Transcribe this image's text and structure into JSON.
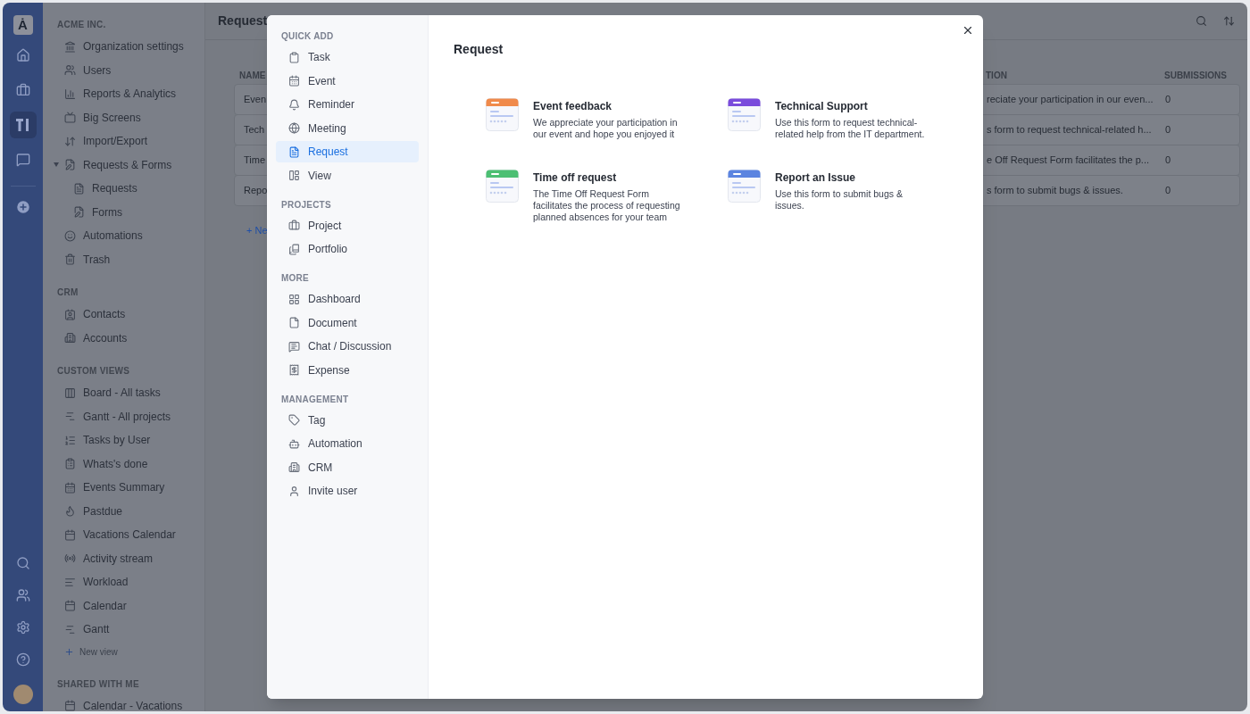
{
  "rail": {
    "logo": "Ȧ",
    "items": [
      {
        "selected": false
      },
      {
        "selected": false
      },
      {
        "selected": true
      },
      {
        "selected": false
      }
    ]
  },
  "sidebar": {
    "sections": [
      {
        "title": "ACME INC.",
        "items": [
          {
            "label": "Organization settings"
          },
          {
            "label": "Users"
          },
          {
            "label": "Reports & Analytics"
          },
          {
            "label": "Big Screens"
          },
          {
            "label": "Import/Export"
          },
          {
            "label": "Requests & Forms",
            "expanded": true,
            "children": [
              {
                "label": "Requests"
              },
              {
                "label": "Forms"
              }
            ]
          },
          {
            "label": "Automations"
          },
          {
            "label": "Trash"
          }
        ]
      },
      {
        "title": "CRM",
        "items": [
          {
            "label": "Contacts"
          },
          {
            "label": "Accounts"
          }
        ]
      },
      {
        "title": "CUSTOM VIEWS",
        "items": [
          {
            "label": "Board - All tasks"
          },
          {
            "label": "Gantt - All projects"
          },
          {
            "label": "Tasks by User"
          },
          {
            "label": "Whats's done"
          },
          {
            "label": "Events Summary"
          },
          {
            "label": "Pastdue"
          },
          {
            "label": "Vacations Calendar"
          },
          {
            "label": "Activity stream"
          },
          {
            "label": "Workload"
          },
          {
            "label": "Calendar"
          },
          {
            "label": "Gantt"
          }
        ],
        "add_link": "New view"
      },
      {
        "title": "SHARED WITH ME",
        "items": [
          {
            "label": "Calendar - Vacations"
          }
        ]
      }
    ]
  },
  "page": {
    "title": "Request",
    "table": {
      "columns": [
        "NAME",
        "TION",
        "SUBMISSIONS"
      ],
      "rows": [
        {
          "name": "Even",
          "description": "reciate your participation in our even...",
          "submissions": "0"
        },
        {
          "name": "Tech",
          "description": "s form to request technical-related h...",
          "submissions": "0"
        },
        {
          "name": "Time",
          "description": "e Off Request Form facilitates the p...",
          "submissions": "0"
        },
        {
          "name": "Repo",
          "description": "s form to submit bugs & issues.",
          "submissions": "0"
        }
      ]
    },
    "new_link": "+ Ne"
  },
  "modal": {
    "nav": [
      {
        "title": "QUICK ADD",
        "items": [
          {
            "label": "Task",
            "selected": false
          },
          {
            "label": "Event",
            "selected": false
          },
          {
            "label": "Reminder",
            "selected": false
          },
          {
            "label": "Meeting",
            "selected": false
          },
          {
            "label": "Request",
            "selected": true
          },
          {
            "label": "View",
            "selected": false
          }
        ]
      },
      {
        "title": "PROJECTS",
        "items": [
          {
            "label": "Project",
            "selected": false
          },
          {
            "label": "Portfolio",
            "selected": false
          }
        ]
      },
      {
        "title": "MORE",
        "items": [
          {
            "label": "Dashboard",
            "selected": false
          },
          {
            "label": "Document",
            "selected": false
          },
          {
            "label": "Chat / Discussion",
            "selected": false
          },
          {
            "label": "Expense",
            "selected": false
          }
        ]
      },
      {
        "title": "MANAGEMENT",
        "items": [
          {
            "label": "Tag",
            "selected": false
          },
          {
            "label": "Automation",
            "selected": false
          },
          {
            "label": "CRM",
            "selected": false
          },
          {
            "label": "Invite user",
            "selected": false
          }
        ]
      }
    ],
    "heading": "Request",
    "templates": [
      {
        "title": "Event feedback",
        "description": "We appreciate your participation in our event and hope you enjoyed it",
        "color": "#f08a4b"
      },
      {
        "title": "Technical Support",
        "description": "Use this form to request technical-related help from the IT department.",
        "color": "#7a4bdc"
      },
      {
        "title": "Time off request",
        "description": "The Time Off Request Form facilitates the process of requesting planned absences for your team",
        "color": "#4cbf73"
      },
      {
        "title": "Report an Issue",
        "description": "Use this form to submit bugs & issues.",
        "color": "#5b84e0"
      }
    ]
  }
}
